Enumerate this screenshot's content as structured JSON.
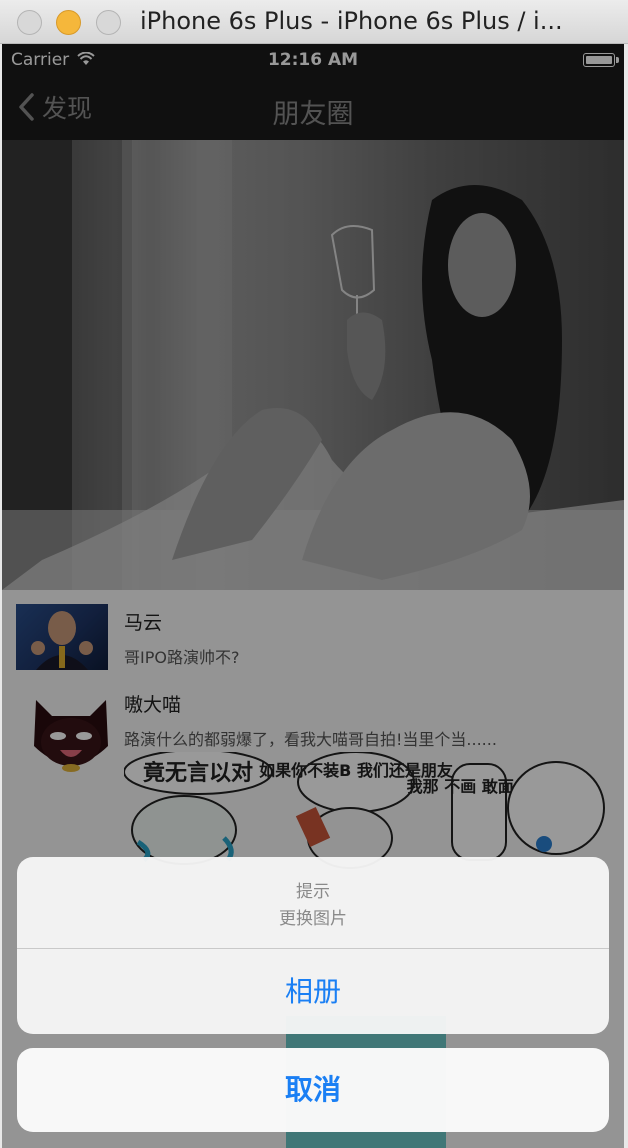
{
  "window": {
    "title": "iPhone 6s Plus - iPhone 6s Plus / i..."
  },
  "statusbar": {
    "carrier": "Carrier",
    "time": "12:16 AM"
  },
  "navbar": {
    "back_label": "发现",
    "title": "朋友圈"
  },
  "feed": {
    "posts": [
      {
        "name": "马云",
        "text": "哥IPO路演帅不?"
      },
      {
        "name": "嗷大喵",
        "text": "路演什么的都弱爆了，看我大喵哥自拍!当里个当......"
      }
    ],
    "stickers": [
      {
        "caption": "竟无言以对"
      },
      {
        "caption": "如果你不装B 我们还是朋友"
      },
      {
        "caption": "我那 不画 敢面 看太"
      }
    ]
  },
  "action_sheet": {
    "title": "提示",
    "message": "更换图片",
    "action_label": "相册",
    "cancel_label": "取消",
    "accent_color": "#1a7ff4"
  }
}
